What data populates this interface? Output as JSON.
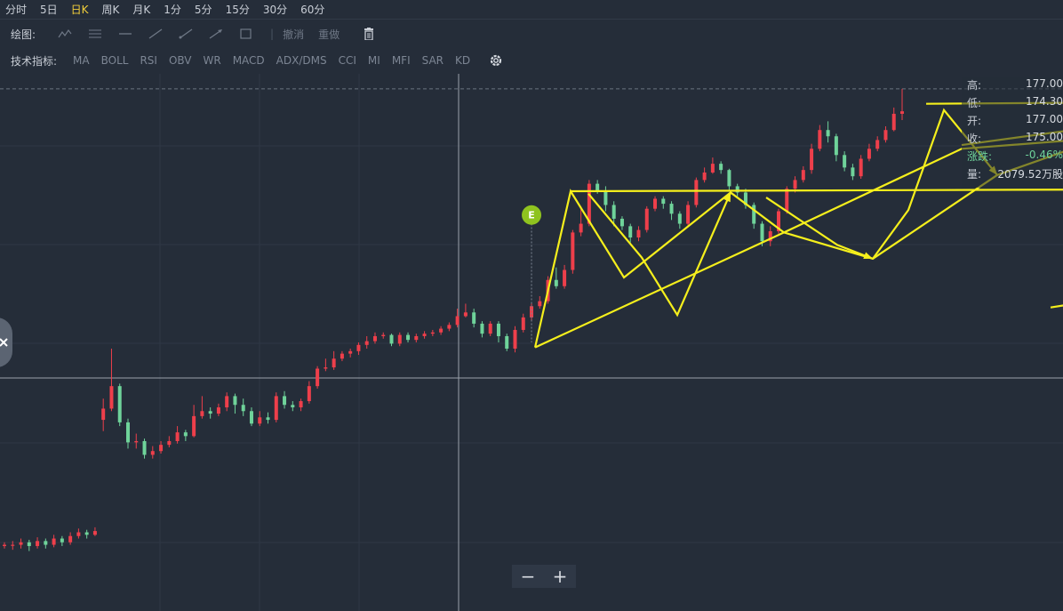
{
  "periods": [
    "分时",
    "5日",
    "日K",
    "周K",
    "月K",
    "1分",
    "5分",
    "15分",
    "30分",
    "60分"
  ],
  "active_period": "日K",
  "draw": {
    "label": "绘图:",
    "undo": "撤消",
    "redo": "重做",
    "tools": [
      "polyline-icon",
      "parallel-lines-icon",
      "horizontal-line-icon",
      "line-icon",
      "ray-icon",
      "arrow-icon",
      "rectangle-icon"
    ]
  },
  "indicators": {
    "label": "技术指标:",
    "items": [
      "MA",
      "BOLL",
      "RSI",
      "OBV",
      "WR",
      "MACD",
      "ADX/DMS",
      "CCI",
      "MI",
      "MFI",
      "SAR",
      "KD"
    ]
  },
  "info": [
    {
      "k": "高:",
      "v": "177.00"
    },
    {
      "k": "低:",
      "v": "174.30"
    },
    {
      "k": "开:",
      "v": "177.00"
    },
    {
      "k": "收:",
      "v": "175.00"
    },
    {
      "k": "涨跌:",
      "v": "-0.46%"
    },
    {
      "k": "量:",
      "v": "2079.52万股"
    }
  ],
  "colors": {
    "background": "#252d39",
    "up": "#ee3f4b",
    "down": "#6fd39a",
    "annotation": "#f5ef1c",
    "active": "#f2cf3a",
    "badge": "#8fc31f"
  },
  "chart_data": {
    "type": "candlestick",
    "ylim": [
      135,
      178
    ],
    "event_badge": "E",
    "candles": [
      [
        140.2,
        140.3,
        140.5,
        140.0
      ],
      [
        140.3,
        140.3,
        140.6,
        139.9
      ],
      [
        140.3,
        140.5,
        140.8,
        140.0
      ],
      [
        140.5,
        140.2,
        140.7,
        139.8
      ],
      [
        140.2,
        140.6,
        140.9,
        140.0
      ],
      [
        140.6,
        140.3,
        140.8,
        140.0
      ],
      [
        140.3,
        140.8,
        141.1,
        140.1
      ],
      [
        140.8,
        140.5,
        141.0,
        140.2
      ],
      [
        140.5,
        141.0,
        141.3,
        140.3
      ],
      [
        141.0,
        141.3,
        141.6,
        140.8
      ],
      [
        141.3,
        141.1,
        141.5,
        140.8
      ],
      [
        141.1,
        141.4,
        141.7,
        141.0
      ],
      [
        150.3,
        151.2,
        152.0,
        149.4
      ],
      [
        151.2,
        153.0,
        156.0,
        151.0
      ],
      [
        153.0,
        150.1,
        153.2,
        149.8
      ],
      [
        150.1,
        148.5,
        150.4,
        148.0
      ],
      [
        148.5,
        148.6,
        149.2,
        148.0
      ],
      [
        148.6,
        147.5,
        148.8,
        147.2
      ],
      [
        147.5,
        147.8,
        148.2,
        147.2
      ],
      [
        147.8,
        148.3,
        148.6,
        147.6
      ],
      [
        148.3,
        148.6,
        149.0,
        148.1
      ],
      [
        148.6,
        149.3,
        149.8,
        148.4
      ],
      [
        149.3,
        149.0,
        149.5,
        148.6
      ],
      [
        149.0,
        150.6,
        151.5,
        148.9
      ],
      [
        150.6,
        151.0,
        152.2,
        150.4
      ],
      [
        151.0,
        150.8,
        151.3,
        150.4
      ],
      [
        150.8,
        151.3,
        151.6,
        150.6
      ],
      [
        151.3,
        152.2,
        152.5,
        151.0
      ],
      [
        152.2,
        151.5,
        152.4,
        150.8
      ],
      [
        151.5,
        151.0,
        152.0,
        150.6
      ],
      [
        151.0,
        150.0,
        151.3,
        149.8
      ],
      [
        150.0,
        150.5,
        151.0,
        149.8
      ],
      [
        150.5,
        150.3,
        150.9,
        150.0
      ],
      [
        150.3,
        152.2,
        152.5,
        150.1
      ],
      [
        152.2,
        151.5,
        152.6,
        151.2
      ],
      [
        151.5,
        151.3,
        151.8,
        151.0
      ],
      [
        151.3,
        151.8,
        152.0,
        151.0
      ],
      [
        151.8,
        153.0,
        153.4,
        151.6
      ],
      [
        153.0,
        154.4,
        154.6,
        152.8
      ],
      [
        154.4,
        154.5,
        155.2,
        154.2
      ],
      [
        154.5,
        155.2,
        155.8,
        154.3
      ],
      [
        155.2,
        155.6,
        155.8,
        155.0
      ],
      [
        155.6,
        155.8,
        156.0,
        155.3
      ],
      [
        155.8,
        156.3,
        156.5,
        155.5
      ],
      [
        156.3,
        156.6,
        157.0,
        156.0
      ],
      [
        156.6,
        157.0,
        157.3,
        156.4
      ],
      [
        157.0,
        157.1,
        157.3,
        156.8
      ],
      [
        157.1,
        156.4,
        157.2,
        156.2
      ],
      [
        156.4,
        157.1,
        157.3,
        156.2
      ],
      [
        157.1,
        156.7,
        157.3,
        156.5
      ],
      [
        156.7,
        157.0,
        157.2,
        156.5
      ],
      [
        157.0,
        157.2,
        157.4,
        156.8
      ],
      [
        157.2,
        157.3,
        157.5,
        157.0
      ],
      [
        157.3,
        157.6,
        157.8,
        157.1
      ],
      [
        157.6,
        157.9,
        158.1,
        157.4
      ],
      [
        157.9,
        158.6,
        159.2,
        157.7
      ],
      [
        158.6,
        158.9,
        159.6,
        158.5
      ],
      [
        158.9,
        158.0,
        159.2,
        157.7
      ],
      [
        158.0,
        157.2,
        158.2,
        156.9
      ],
      [
        157.2,
        158.0,
        158.2,
        157.0
      ],
      [
        158.0,
        157.0,
        158.2,
        156.5
      ],
      [
        157.0,
        156.0,
        157.2,
        155.8
      ],
      [
        156.0,
        157.5,
        157.8,
        155.7
      ],
      [
        157.5,
        158.5,
        158.8,
        157.3
      ],
      [
        158.5,
        159.4,
        159.6,
        158.2
      ],
      [
        159.4,
        159.8,
        160.2,
        159.2
      ],
      [
        159.8,
        161.5,
        161.8,
        159.6
      ],
      [
        161.5,
        161.0,
        162.5,
        160.8
      ],
      [
        161.0,
        162.3,
        162.7,
        160.8
      ],
      [
        162.3,
        165.3,
        165.5,
        162.0
      ],
      [
        165.3,
        166.0,
        167.4,
        165.0
      ],
      [
        166.0,
        169.2,
        169.5,
        165.8
      ],
      [
        169.2,
        168.6,
        169.5,
        168.4
      ],
      [
        168.6,
        167.5,
        169.0,
        167.0
      ],
      [
        167.5,
        166.4,
        167.8,
        165.8
      ],
      [
        166.4,
        165.8,
        166.6,
        165.5
      ],
      [
        165.8,
        164.9,
        166.0,
        164.5
      ],
      [
        164.9,
        165.5,
        165.8,
        164.6
      ],
      [
        165.5,
        167.2,
        167.4,
        165.3
      ],
      [
        167.2,
        168.0,
        168.2,
        167.0
      ],
      [
        168.0,
        167.6,
        168.2,
        167.2
      ],
      [
        167.6,
        166.8,
        167.8,
        166.3
      ],
      [
        166.8,
        166.0,
        167.0,
        165.6
      ],
      [
        166.0,
        167.5,
        167.8,
        165.8
      ],
      [
        167.5,
        169.5,
        169.7,
        167.3
      ],
      [
        169.5,
        170.1,
        170.5,
        169.3
      ],
      [
        170.1,
        170.8,
        171.3,
        170.0
      ],
      [
        170.8,
        170.3,
        171.0,
        170.0
      ],
      [
        170.3,
        169.0,
        170.4,
        168.7
      ],
      [
        169.0,
        168.5,
        169.2,
        168.2
      ],
      [
        168.5,
        167.5,
        168.8,
        167.2
      ],
      [
        167.5,
        166.0,
        167.7,
        165.6
      ],
      [
        166.0,
        164.6,
        166.2,
        164.2
      ],
      [
        164.6,
        165.4,
        165.8,
        164.2
      ],
      [
        165.4,
        167.0,
        167.2,
        165.2
      ],
      [
        167.0,
        168.8,
        169.0,
        166.8
      ],
      [
        168.8,
        169.5,
        169.8,
        168.5
      ],
      [
        169.5,
        170.3,
        170.6,
        169.3
      ],
      [
        170.3,
        172.0,
        172.4,
        170.0
      ],
      [
        172.0,
        173.5,
        173.9,
        171.8
      ],
      [
        173.5,
        173.0,
        174.2,
        172.5
      ],
      [
        173.0,
        171.5,
        173.2,
        171.0
      ],
      [
        171.5,
        170.5,
        171.8,
        170.2
      ],
      [
        170.5,
        169.8,
        170.8,
        169.5
      ],
      [
        169.8,
        171.2,
        171.5,
        169.6
      ],
      [
        171.2,
        172.0,
        172.4,
        171.0
      ],
      [
        172.0,
        172.7,
        173.0,
        171.8
      ],
      [
        172.7,
        173.5,
        173.8,
        172.5
      ],
      [
        173.5,
        174.8,
        175.3,
        173.4
      ],
      [
        174.8,
        175.0,
        176.8,
        174.3
      ]
    ],
    "annotation_polylines": [
      [
        [
          0,
          156.1
        ],
        [
          2,
          168.6
        ],
        [
          5,
          161.7
        ],
        [
          11,
          168.5
        ],
        [
          14,
          165.3
        ],
        [
          19,
          163.2
        ],
        [
          26,
          169.9
        ],
        [
          33,
          173.4
        ],
        [
          35,
          174.9
        ]
      ],
      [
        [
          0,
          156.1
        ],
        [
          14,
          165.3
        ],
        [
          24,
          172.0
        ],
        [
          45,
          174.3
        ],
        [
          53,
          174.5
        ]
      ],
      [
        [
          29,
          159.3
        ],
        [
          53,
          164.6
        ]
      ],
      [
        [
          2,
          168.6
        ],
        [
          45,
          168.8
        ]
      ],
      [
        [
          22,
          175.6
        ],
        [
          43,
          175.8
        ]
      ],
      [
        [
          24,
          172.3
        ],
        [
          39,
          175.2
        ],
        [
          39,
          177.0
        ],
        [
          46,
          177.8
        ]
      ],
      [
        [
          19,
          163.2
        ],
        [
          21,
          167.1
        ],
        [
          23,
          175.1
        ],
        [
          26,
          169.9
        ]
      ],
      [
        [
          3,
          168.4
        ],
        [
          6,
          163.3
        ],
        [
          8,
          158.7
        ],
        [
          11,
          168.5
        ]
      ],
      [
        [
          13,
          168.1
        ],
        [
          17,
          164.3
        ],
        [
          19,
          163.2
        ]
      ]
    ]
  }
}
